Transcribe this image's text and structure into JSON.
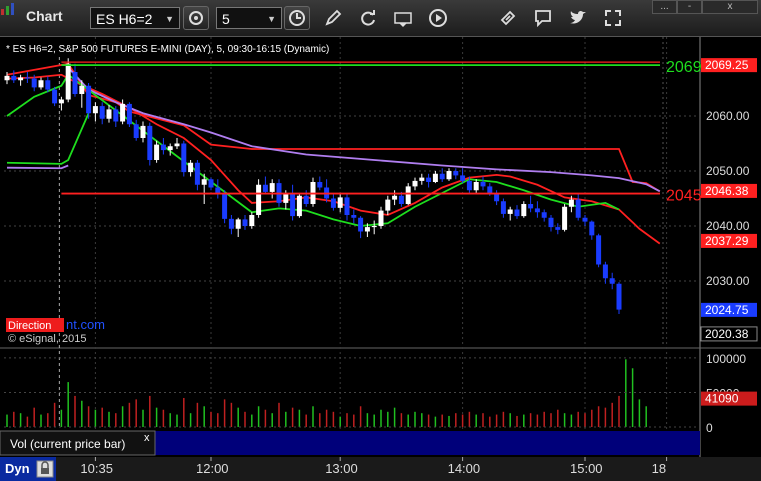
{
  "toolbar": {
    "title": "Chart",
    "symbol": "ES H6=2",
    "interval": "5",
    "icons": [
      "settings-icon",
      "clock-icon",
      "draw-pen-icon",
      "refresh-icon",
      "get-data-icon",
      "play-icon",
      "link-icon",
      "comment-icon",
      "twitter-icon",
      "expand-icon"
    ],
    "window_controls": [
      "...",
      "-",
      "x"
    ]
  },
  "chart_info": "* ES H6=2, S&P 500 FUTURES E-MINI (DAY), 5, 09:30-16:15 (Dynamic)",
  "watermark_brand": "Direction",
  "watermark_rest": "nt.com",
  "copyright": "© eSignal, 2015",
  "vol_legend": "Vol (current price bar)",
  "vol_close": "x",
  "bottom_bar": {
    "label": "Dyn",
    "lock_icon": "lock-icon"
  },
  "colors": {
    "up": "#ffffff",
    "down": "#1a3cff",
    "ma_red": "#ff2020",
    "ma_purple": "#b07ef0",
    "ma_green": "#1ede1e",
    "vol_up": "#20c020",
    "vol_down": "#c02020",
    "background": "#000000"
  },
  "chart_data": [
    {
      "type": "candlestick",
      "title": "",
      "x_tick_labels": [
        "10:35",
        "12:00",
        "13:00",
        "14:00",
        "15:00",
        "18"
      ],
      "ylim": [
        2018,
        2074
      ],
      "y_ticks": [
        2030.0,
        2040.0,
        2050.0,
        2060.0
      ],
      "y_tick_labels": [
        "2030.00",
        "2040.00",
        "2050.00",
        "2060.00"
      ],
      "grid": true,
      "price_tags": [
        {
          "label": "2069.25",
          "value": 2069.25,
          "color": "#ff2020"
        },
        {
          "label": "2046.38",
          "value": 2046.38,
          "color": "#ff2020"
        },
        {
          "label": "2037.29",
          "value": 2037.29,
          "color": "#ff2020"
        },
        {
          "label": "2024.75",
          "value": 2024.75,
          "color": "#1a3cff"
        },
        {
          "label": "2020.38",
          "value": 2020.38,
          "color": "#000000"
        }
      ],
      "horizontal_levels": [
        {
          "label": "2069",
          "value": 2069.25,
          "color": "#1ede1e"
        },
        {
          "label": "2045",
          "value": 2045.9,
          "color": "#ff2020"
        }
      ],
      "candles": [
        [
          2066.5,
          2068.0,
          2065.8,
          2067.3
        ],
        [
          2067.3,
          2068.3,
          2066.0,
          2066.5
        ],
        [
          2066.5,
          2067.5,
          2065.5,
          2067.0
        ],
        [
          2067.0,
          2068.0,
          2066.0,
          2066.8
        ],
        [
          2066.8,
          2067.5,
          2064.5,
          2065.2
        ],
        [
          2065.2,
          2067.0,
          2064.8,
          2066.5
        ],
        [
          2066.5,
          2067.2,
          2064.3,
          2064.8
        ],
        [
          2064.8,
          2065.3,
          2061.8,
          2062.3
        ],
        [
          2062.3,
          2063.5,
          2061.0,
          2063.0
        ],
        [
          2063.0,
          2070.5,
          2062.5,
          2069.5
        ],
        [
          2068.0,
          2069.5,
          2063.5,
          2064.0
        ],
        [
          2064.0,
          2066.5,
          2061.5,
          2065.5
        ],
        [
          2065.5,
          2066.0,
          2059.5,
          2060.5
        ],
        [
          2060.5,
          2062.5,
          2059.0,
          2061.8
        ],
        [
          2061.8,
          2062.5,
          2058.5,
          2059.5
        ],
        [
          2059.5,
          2062.0,
          2058.8,
          2061.2
        ],
        [
          2061.2,
          2061.8,
          2058.0,
          2059.0
        ],
        [
          2059.0,
          2063.0,
          2058.5,
          2062.2
        ],
        [
          2062.2,
          2062.5,
          2058.0,
          2058.5
        ],
        [
          2058.5,
          2059.3,
          2055.5,
          2056.0
        ],
        [
          2056.0,
          2059.0,
          2055.2,
          2058.2
        ],
        [
          2058.2,
          2058.8,
          2051.0,
          2052.0
        ],
        [
          2052.0,
          2055.5,
          2051.5,
          2054.8
        ],
        [
          2054.8,
          2056.0,
          2053.0,
          2053.8
        ],
        [
          2053.8,
          2055.0,
          2052.8,
          2054.5
        ],
        [
          2054.5,
          2056.0,
          2054.0,
          2055.0
        ],
        [
          2055.0,
          2055.5,
          2049.0,
          2049.8
        ],
        [
          2049.8,
          2052.0,
          2049.0,
          2051.5
        ],
        [
          2051.5,
          2052.0,
          2046.5,
          2047.5
        ],
        [
          2047.5,
          2049.5,
          2044.0,
          2048.5
        ],
        [
          2048.5,
          2048.8,
          2046.5,
          2047.0
        ],
        [
          2047.0,
          2048.5,
          2045.0,
          2046.0
        ],
        [
          2046.0,
          2046.5,
          2040.5,
          2041.3
        ],
        [
          2041.3,
          2042.0,
          2038.5,
          2039.5
        ],
        [
          2039.5,
          2041.5,
          2038.0,
          2041.2
        ],
        [
          2041.2,
          2042.0,
          2039.3,
          2040.0
        ],
        [
          2040.0,
          2042.5,
          2039.5,
          2042.0
        ],
        [
          2042.0,
          2048.5,
          2041.5,
          2047.5
        ],
        [
          2047.5,
          2049.0,
          2045.8,
          2046.2
        ],
        [
          2046.2,
          2048.5,
          2045.0,
          2047.8
        ],
        [
          2047.8,
          2048.5,
          2043.5,
          2044.2
        ],
        [
          2044.2,
          2046.5,
          2043.0,
          2045.8
        ],
        [
          2045.8,
          2047.5,
          2041.0,
          2041.8
        ],
        [
          2041.8,
          2046.0,
          2041.5,
          2045.5
        ],
        [
          2045.5,
          2046.5,
          2043.5,
          2044.0
        ],
        [
          2044.0,
          2048.8,
          2043.5,
          2048.0
        ],
        [
          2048.0,
          2049.0,
          2046.5,
          2047.0
        ],
        [
          2047.0,
          2048.5,
          2044.3,
          2045.0
        ],
        [
          2045.0,
          2045.8,
          2042.8,
          2043.3
        ],
        [
          2043.3,
          2046.0,
          2042.5,
          2045.2
        ],
        [
          2045.2,
          2046.0,
          2041.0,
          2042.0
        ],
        [
          2042.0,
          2043.0,
          2040.5,
          2041.5
        ],
        [
          2041.5,
          2041.8,
          2037.8,
          2039.0
        ],
        [
          2039.0,
          2040.5,
          2038.0,
          2039.8
        ],
        [
          2039.8,
          2041.0,
          2038.5,
          2040.0
        ],
        [
          2040.0,
          2043.5,
          2039.5,
          2042.8
        ],
        [
          2042.8,
          2045.5,
          2042.0,
          2044.8
        ],
        [
          2044.8,
          2046.5,
          2043.8,
          2045.5
        ],
        [
          2045.5,
          2046.2,
          2043.5,
          2044.0
        ],
        [
          2044.0,
          2047.8,
          2043.8,
          2047.2
        ],
        [
          2047.2,
          2048.8,
          2046.5,
          2048.2
        ],
        [
          2048.2,
          2049.5,
          2047.5,
          2048.8
        ],
        [
          2048.8,
          2049.5,
          2047.0,
          2048.0
        ],
        [
          2048.0,
          2050.0,
          2047.8,
          2049.5
        ],
        [
          2049.5,
          2050.5,
          2048.0,
          2048.5
        ],
        [
          2048.5,
          2050.5,
          2048.2,
          2050.0
        ],
        [
          2050.0,
          2050.5,
          2048.5,
          2049.2
        ],
        [
          2049.2,
          2050.5,
          2047.8,
          2048.2
        ],
        [
          2048.2,
          2049.0,
          2046.0,
          2046.5
        ],
        [
          2046.5,
          2048.5,
          2046.0,
          2048.0
        ],
        [
          2048.0,
          2049.0,
          2046.5,
          2047.2
        ],
        [
          2047.2,
          2047.8,
          2045.5,
          2046.0
        ],
        [
          2046.0,
          2046.5,
          2043.8,
          2044.5
        ],
        [
          2044.5,
          2045.0,
          2041.5,
          2042.2
        ],
        [
          2042.2,
          2043.5,
          2041.0,
          2043.0
        ],
        [
          2043.0,
          2043.8,
          2041.3,
          2041.8
        ],
        [
          2041.8,
          2044.5,
          2041.5,
          2044.0
        ],
        [
          2044.0,
          2045.5,
          2042.5,
          2043.2
        ],
        [
          2043.2,
          2044.5,
          2041.5,
          2042.5
        ],
        [
          2042.5,
          2043.0,
          2040.8,
          2041.5
        ],
        [
          2041.5,
          2042.0,
          2039.0,
          2039.8
        ],
        [
          2039.8,
          2040.5,
          2038.5,
          2039.3
        ],
        [
          2039.3,
          2044.0,
          2039.0,
          2043.5
        ],
        [
          2043.5,
          2045.5,
          2042.5,
          2044.8
        ],
        [
          2044.8,
          2046.0,
          2041.0,
          2041.5
        ],
        [
          2041.5,
          2042.0,
          2040.0,
          2040.8
        ],
        [
          2040.8,
          2041.0,
          2037.5,
          2038.3
        ],
        [
          2038.3,
          2038.6,
          2032.5,
          2033.0
        ],
        [
          2033.0,
          2033.5,
          2029.5,
          2030.5
        ],
        [
          2030.5,
          2031.5,
          2028.5,
          2029.5
        ],
        [
          2029.5,
          2029.8,
          2024.0,
          2024.8
        ]
      ],
      "moving_averages": [
        {
          "color": "#ff2020",
          "type": "step",
          "values": [
            [
              0,
              2067.5
            ],
            [
              9,
              2069.5
            ],
            [
              12,
              2063.8
            ],
            [
              16,
              2062.5
            ],
            [
              18,
              2060.8
            ],
            [
              26,
              2058.3
            ],
            [
              30,
              2054.8
            ],
            [
              36,
              2054.0
            ],
            [
              90,
              2054.0
            ],
            [
              92,
              2048.0
            ],
            [
              94,
              2047.8
            ],
            [
              96,
              2046.3
            ]
          ]
        },
        {
          "color": "#ff2020",
          "type": "curve",
          "values": [
            [
              0,
              2066.8
            ],
            [
              4,
              2067.0
            ],
            [
              8,
              2067.5
            ],
            [
              10,
              2066.2
            ],
            [
              14,
              2064.0
            ],
            [
              18,
              2061.5
            ],
            [
              22,
              2058.5
            ],
            [
              26,
              2056.0
            ],
            [
              30,
              2052.0
            ],
            [
              34,
              2046.5
            ],
            [
              36,
              2044.2
            ],
            [
              40,
              2044.5
            ],
            [
              44,
              2045.2
            ],
            [
              48,
              2044.5
            ],
            [
              52,
              2042.8
            ],
            [
              56,
              2042.0
            ],
            [
              60,
              2044.2
            ],
            [
              64,
              2047.0
            ],
            [
              68,
              2048.8
            ],
            [
              72,
              2049.3
            ],
            [
              74,
              2049.0
            ],
            [
              78,
              2047.5
            ],
            [
              82,
              2045.2
            ],
            [
              86,
              2044.5
            ],
            [
              90,
              2043.0
            ],
            [
              93,
              2039.5
            ],
            [
              96,
              2036.8
            ]
          ]
        },
        {
          "color": "#b07ef0",
          "type": "curve",
          "values": [
            [
              9,
              2068.8
            ],
            [
              12,
              2064.8
            ],
            [
              16,
              2062.5
            ],
            [
              20,
              2060.5
            ],
            [
              26,
              2058.5
            ],
            [
              30,
              2057.0
            ],
            [
              36,
              2054.5
            ],
            [
              44,
              2053.0
            ],
            [
              54,
              2052.0
            ],
            [
              64,
              2051.0
            ],
            [
              72,
              2050.3
            ],
            [
              80,
              2049.8
            ],
            [
              86,
              2049.2
            ],
            [
              90,
              2048.7
            ],
            [
              94,
              2047.6
            ],
            [
              96,
              2046.3
            ]
          ]
        },
        {
          "color": "#1ede1e",
          "type": "curve",
          "values": [
            [
              0,
              2060.0
            ],
            [
              4,
              2063.5
            ],
            [
              8,
              2065.5
            ],
            [
              9,
              2067.5
            ],
            [
              36,
              2042.5
            ],
            [
              40,
              2043.2
            ],
            [
              44,
              2042.8
            ],
            [
              48,
              2041.2
            ],
            [
              52,
              2040.0
            ],
            [
              56,
              2040.5
            ],
            [
              60,
              2043.5
            ],
            [
              64,
              2046.0
            ],
            [
              68,
              2048.5
            ],
            [
              72,
              2048.0
            ],
            [
              76,
              2046.5
            ],
            [
              80,
              2044.8
            ],
            [
              84,
              2043.5
            ],
            [
              88,
              2044.2
            ],
            [
              90,
              2043.0
            ]
          ]
        },
        {
          "color": "#1ede1e",
          "type": "curve",
          "values": [
            [
              0,
              2051.5
            ],
            [
              8,
              2051.3
            ],
            [
              9,
              2052.0
            ],
            [
              12,
              2060.5
            ]
          ]
        },
        {
          "color": "#b07ef0",
          "type": "curve",
          "values": [
            [
              0,
              2050.6
            ],
            [
              8,
              2050.5
            ],
            [
              9,
              2051.0
            ]
          ]
        }
      ]
    },
    {
      "type": "bar",
      "title": "",
      "series": [
        {
          "values": [
            18,
            22,
            20,
            15,
            28,
            18,
            20,
            35,
            25,
            65,
            45,
            38,
            30,
            25,
            28,
            22,
            20,
            30,
            35,
            40,
            25,
            45,
            28,
            25,
            20,
            18,
            42,
            20,
            35,
            30,
            22,
            20,
            40,
            35,
            28,
            22,
            18,
            30,
            25,
            20,
            35,
            22,
            28,
            25,
            18,
            30,
            20,
            25,
            22,
            15,
            20,
            18,
            30,
            20,
            18,
            25,
            22,
            28,
            20,
            18,
            22,
            20,
            18,
            15,
            18,
            16,
            20,
            18,
            22,
            18,
            20,
            15,
            18,
            22,
            20,
            16,
            18,
            20,
            18,
            22,
            20,
            25,
            20,
            18,
            22,
            20,
            25,
            30,
            28,
            35,
            45,
            98,
            85,
            40,
            30
          ]
        }
      ],
      "ylim": [
        0,
        110000
      ],
      "y_tick_labels": [
        "0",
        "50000",
        "100000"
      ],
      "current_value_label": "41090"
    }
  ]
}
